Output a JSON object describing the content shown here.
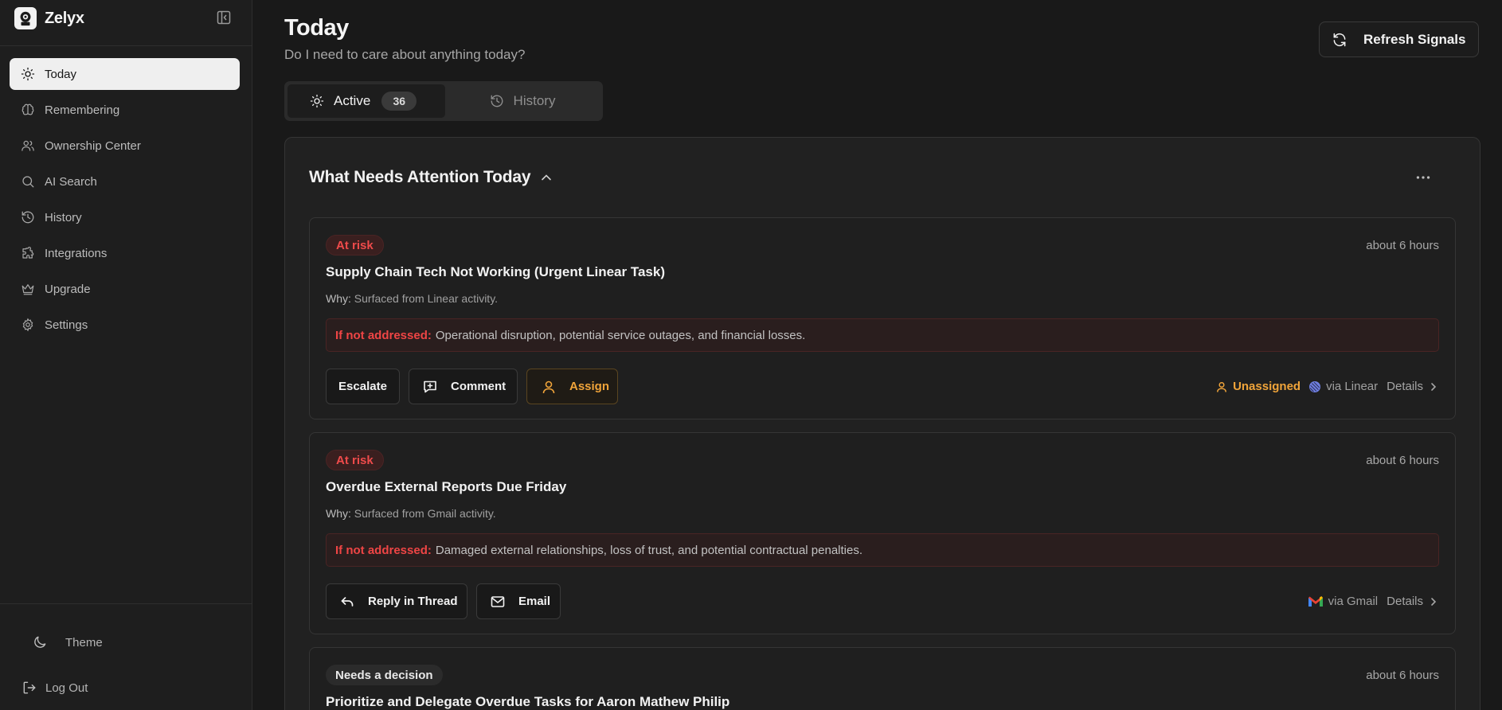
{
  "app": {
    "name": "Zelyx"
  },
  "sidebar": {
    "items": [
      {
        "label": "Today",
        "icon": "sun-icon",
        "active": true
      },
      {
        "label": "Remembering",
        "icon": "brain-icon"
      },
      {
        "label": "Ownership Center",
        "icon": "users-icon"
      },
      {
        "label": "AI Search",
        "icon": "search-icon"
      },
      {
        "label": "History",
        "icon": "history-icon"
      },
      {
        "label": "Integrations",
        "icon": "puzzle-icon"
      },
      {
        "label": "Upgrade",
        "icon": "crown-icon"
      },
      {
        "label": "Settings",
        "icon": "gear-icon"
      }
    ],
    "theme_label": "Theme",
    "logout_label": "Log Out"
  },
  "header": {
    "title": "Today",
    "subtitle": "Do I need to care about anything today?",
    "refresh_label": "Refresh Signals"
  },
  "tabs": {
    "active": {
      "label": "Active",
      "count": "36"
    },
    "history": {
      "label": "History"
    }
  },
  "panel": {
    "title": "What Needs Attention Today",
    "cards": [
      {
        "badge": "At risk",
        "time": "about 6 hours",
        "title": "Supply Chain Tech Not Working (Urgent Linear Task)",
        "why_label": "Why:",
        "why_text": "Surfaced from Linear activity.",
        "impact_label": "If not addressed:",
        "impact_text": "Operational disruption, potential service outages, and financial losses.",
        "actions": [
          "Escalate",
          "Comment",
          "Assign"
        ],
        "owner": "Unassigned",
        "source": "via Linear",
        "details": "Details"
      },
      {
        "badge": "At risk",
        "time": "about 6 hours",
        "title": "Overdue External Reports Due Friday",
        "why_label": "Why:",
        "why_text": "Surfaced from Gmail activity.",
        "impact_label": "If not addressed:",
        "impact_text": "Damaged external relationships, loss of trust, and potential contractual penalties.",
        "actions": [
          "Reply in Thread",
          "Email"
        ],
        "source": "via Gmail",
        "details": "Details"
      },
      {
        "badge": "Needs a decision",
        "time": "about 6 hours",
        "title": "Prioritize and Delegate Overdue Tasks for Aaron Mathew Philip"
      }
    ]
  },
  "colors": {
    "risk": "#ef4545",
    "warning": "#f0a43a",
    "active_nav_bg": "#efefef"
  }
}
